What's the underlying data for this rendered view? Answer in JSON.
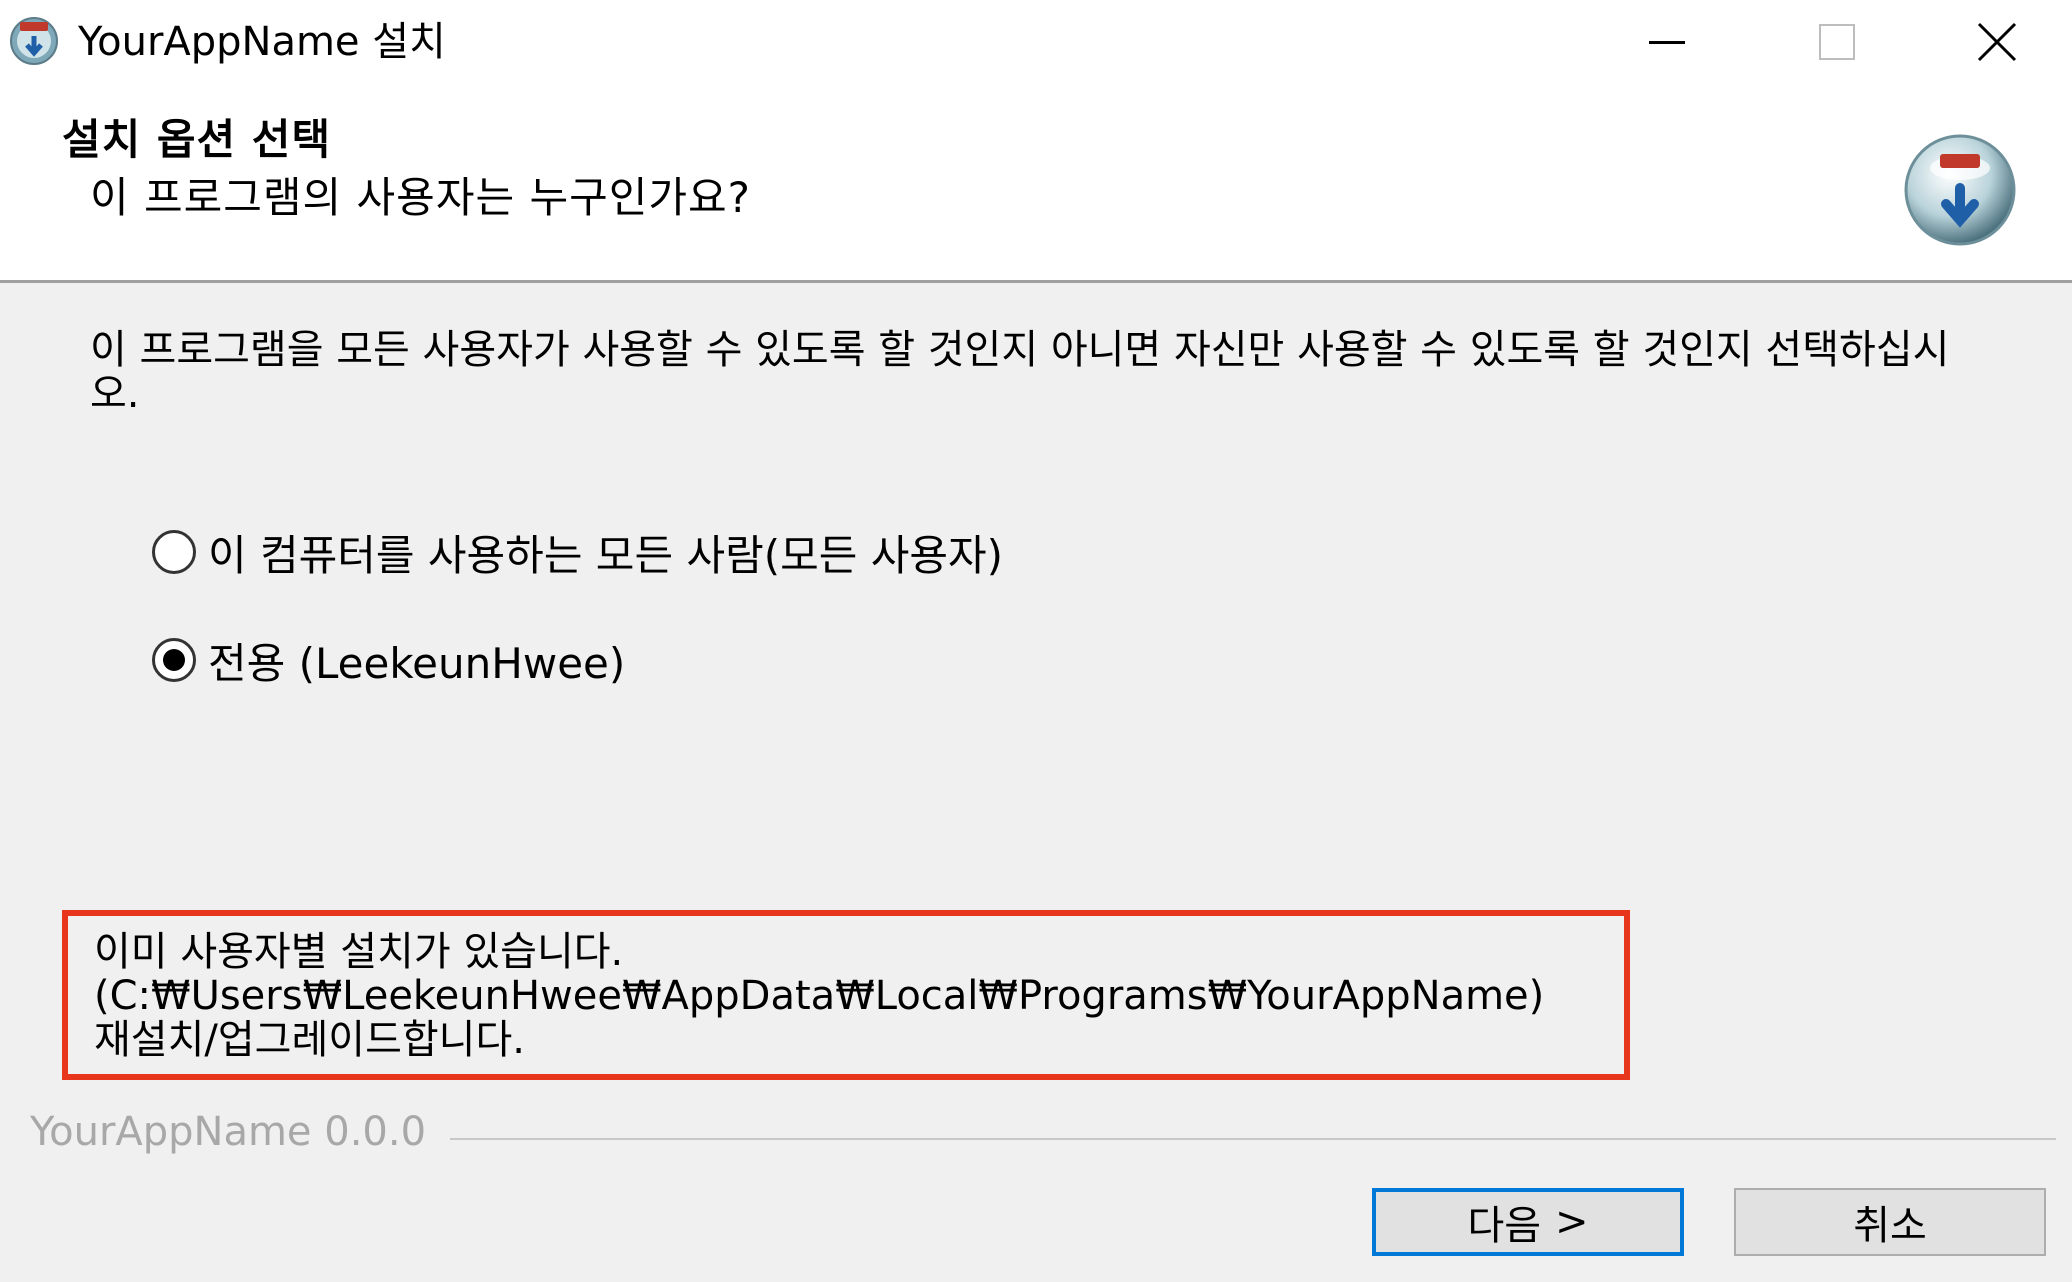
{
  "window": {
    "title": "YourAppName 설치"
  },
  "header": {
    "title": "설치 옵션 선택",
    "subtitle": "이 프로그램의 사용자는 누구인가요?"
  },
  "content": {
    "description": "이 프로그램을 모든 사용자가 사용할 수 있도록 할 것인지 아니면 자신만 사용할 수 있도록 할 것인지 선택하십시오.",
    "options": [
      {
        "label": "이 컴퓨터를 사용하는 모든 사람(모든 사용자)",
        "selected": false
      },
      {
        "label": "전용 (LeekeunHwee)",
        "selected": true
      }
    ],
    "notice": {
      "lines": [
        "이미 사용자별 설치가 있습니다.",
        "(C:₩Users₩LeekeunHwee₩AppData₩Local₩Programs₩YourAppName)",
        "재설치/업그레이드합니다."
      ],
      "border_color": "#e8361c"
    }
  },
  "footer": {
    "brand": "YourAppName 0.0.0",
    "next_label": "다음",
    "next_chevron": ">",
    "cancel_label": "취소"
  },
  "colors": {
    "background": "#f0f0f0",
    "focus_border": "#0078d7"
  },
  "icons": [
    "installer-icon",
    "minimize-icon",
    "maximize-icon",
    "close-icon",
    "installer-globe-icon"
  ]
}
